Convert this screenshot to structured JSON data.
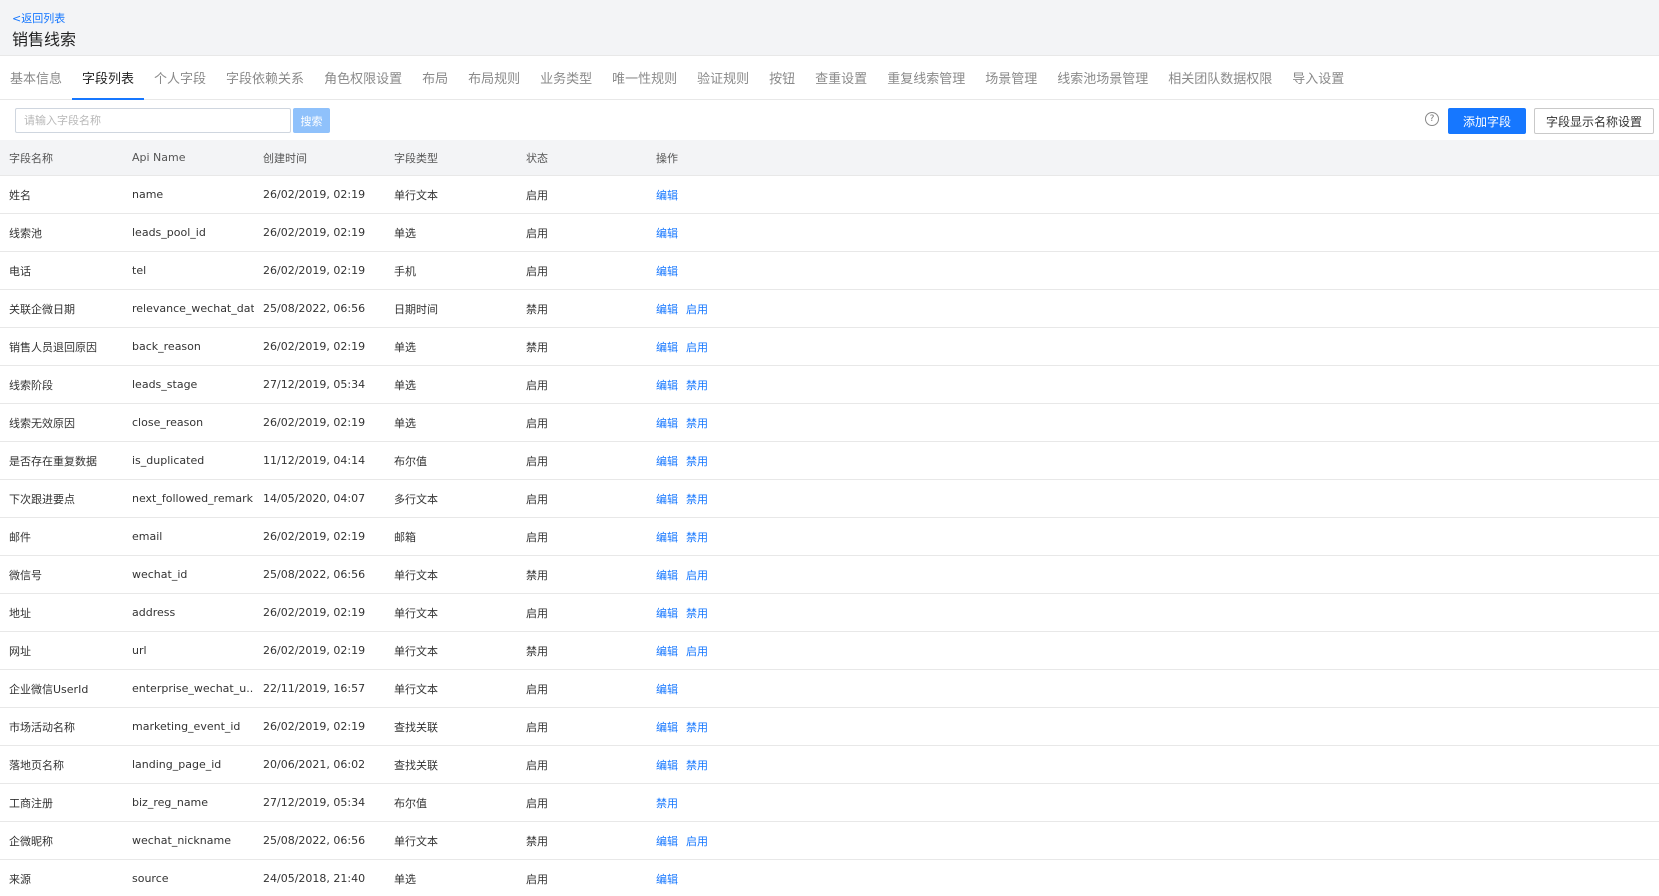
{
  "header": {
    "back_label": "<返回列表",
    "title": "销售线索"
  },
  "tabs": [
    {
      "label": "基本信息",
      "active": false
    },
    {
      "label": "字段列表",
      "active": true
    },
    {
      "label": "个人字段",
      "active": false
    },
    {
      "label": "字段依赖关系",
      "active": false
    },
    {
      "label": "角色权限设置",
      "active": false
    },
    {
      "label": "布局",
      "active": false
    },
    {
      "label": "布局规则",
      "active": false
    },
    {
      "label": "业务类型",
      "active": false
    },
    {
      "label": "唯一性规则",
      "active": false
    },
    {
      "label": "验证规则",
      "active": false
    },
    {
      "label": "按钮",
      "active": false
    },
    {
      "label": "查重设置",
      "active": false
    },
    {
      "label": "重复线索管理",
      "active": false
    },
    {
      "label": "场景管理",
      "active": false
    },
    {
      "label": "线索池场景管理",
      "active": false
    },
    {
      "label": "相关团队数据权限",
      "active": false
    },
    {
      "label": "导入设置",
      "active": false
    }
  ],
  "toolbar": {
    "search_placeholder": "请输入字段名称",
    "search_value": "",
    "search_label": "搜索",
    "help_glyph": "?",
    "help_icon": "question-circle-icon",
    "add_label": "添加字段",
    "name_setting_label": "字段显示名称设置"
  },
  "table": {
    "columns": [
      "字段名称",
      "Api Name",
      "创建时间",
      "字段类型",
      "状态",
      "操作"
    ],
    "rows": [
      {
        "name": "姓名",
        "api": "name",
        "created": "26/02/2019, 02:19",
        "type": "单行文本",
        "status": "启用",
        "actions": [
          "编辑"
        ]
      },
      {
        "name": "线索池",
        "api": "leads_pool_id",
        "created": "26/02/2019, 02:19",
        "type": "单选",
        "status": "启用",
        "actions": [
          "编辑"
        ]
      },
      {
        "name": "电话",
        "api": "tel",
        "created": "26/02/2019, 02:19",
        "type": "手机",
        "status": "启用",
        "actions": [
          "编辑"
        ]
      },
      {
        "name": "关联企微日期",
        "api": "relevance_wechat_date",
        "created": "25/08/2022, 06:56",
        "type": "日期时间",
        "status": "禁用",
        "actions": [
          "编辑",
          "启用"
        ]
      },
      {
        "name": "销售人员退回原因",
        "api": "back_reason",
        "created": "26/02/2019, 02:19",
        "type": "单选",
        "status": "禁用",
        "actions": [
          "编辑",
          "启用"
        ]
      },
      {
        "name": "线索阶段",
        "api": "leads_stage",
        "created": "27/12/2019, 05:34",
        "type": "单选",
        "status": "启用",
        "actions": [
          "编辑",
          "禁用"
        ]
      },
      {
        "name": "线索无效原因",
        "api": "close_reason",
        "created": "26/02/2019, 02:19",
        "type": "单选",
        "status": "启用",
        "actions": [
          "编辑",
          "禁用"
        ]
      },
      {
        "name": "是否存在重复数据",
        "api": "is_duplicated",
        "created": "11/12/2019, 04:14",
        "type": "布尔值",
        "status": "启用",
        "actions": [
          "编辑",
          "禁用"
        ]
      },
      {
        "name": "下次跟进要点",
        "api": "next_followed_remark",
        "created": "14/05/2020, 04:07",
        "type": "多行文本",
        "status": "启用",
        "actions": [
          "编辑",
          "禁用"
        ]
      },
      {
        "name": "邮件",
        "api": "email",
        "created": "26/02/2019, 02:19",
        "type": "邮箱",
        "status": "启用",
        "actions": [
          "编辑",
          "禁用"
        ]
      },
      {
        "name": "微信号",
        "api": "wechat_id",
        "created": "25/08/2022, 06:56",
        "type": "单行文本",
        "status": "禁用",
        "actions": [
          "编辑",
          "启用"
        ]
      },
      {
        "name": "地址",
        "api": "address",
        "created": "26/02/2019, 02:19",
        "type": "单行文本",
        "status": "启用",
        "actions": [
          "编辑",
          "禁用"
        ]
      },
      {
        "name": "网址",
        "api": "url",
        "created": "26/02/2019, 02:19",
        "type": "单行文本",
        "status": "禁用",
        "actions": [
          "编辑",
          "启用"
        ]
      },
      {
        "name": "企业微信UserId",
        "api": "enterprise_wechat_u...",
        "created": "22/11/2019, 16:57",
        "type": "单行文本",
        "status": "启用",
        "actions": [
          "编辑"
        ]
      },
      {
        "name": "市场活动名称",
        "api": "marketing_event_id",
        "created": "26/02/2019, 02:19",
        "type": "查找关联",
        "status": "启用",
        "actions": [
          "编辑",
          "禁用"
        ]
      },
      {
        "name": "落地页名称",
        "api": "landing_page_id",
        "created": "20/06/2021, 06:02",
        "type": "查找关联",
        "status": "启用",
        "actions": [
          "编辑",
          "禁用"
        ]
      },
      {
        "name": "工商注册",
        "api": "biz_reg_name",
        "created": "27/12/2019, 05:34",
        "type": "布尔值",
        "status": "启用",
        "actions": [
          "禁用"
        ]
      },
      {
        "name": "企微昵称",
        "api": "wechat_nickname",
        "created": "25/08/2022, 06:56",
        "type": "单行文本",
        "status": "禁用",
        "actions": [
          "编辑",
          "启用"
        ]
      },
      {
        "name": "来源",
        "api": "source",
        "created": "24/05/2018, 21:40",
        "type": "单选",
        "status": "启用",
        "actions": [
          "编辑"
        ]
      }
    ]
  },
  "colors": {
    "accent": "#1677ff",
    "search_button": "#8fc1fb",
    "header_bg": "#f3f4f6"
  }
}
